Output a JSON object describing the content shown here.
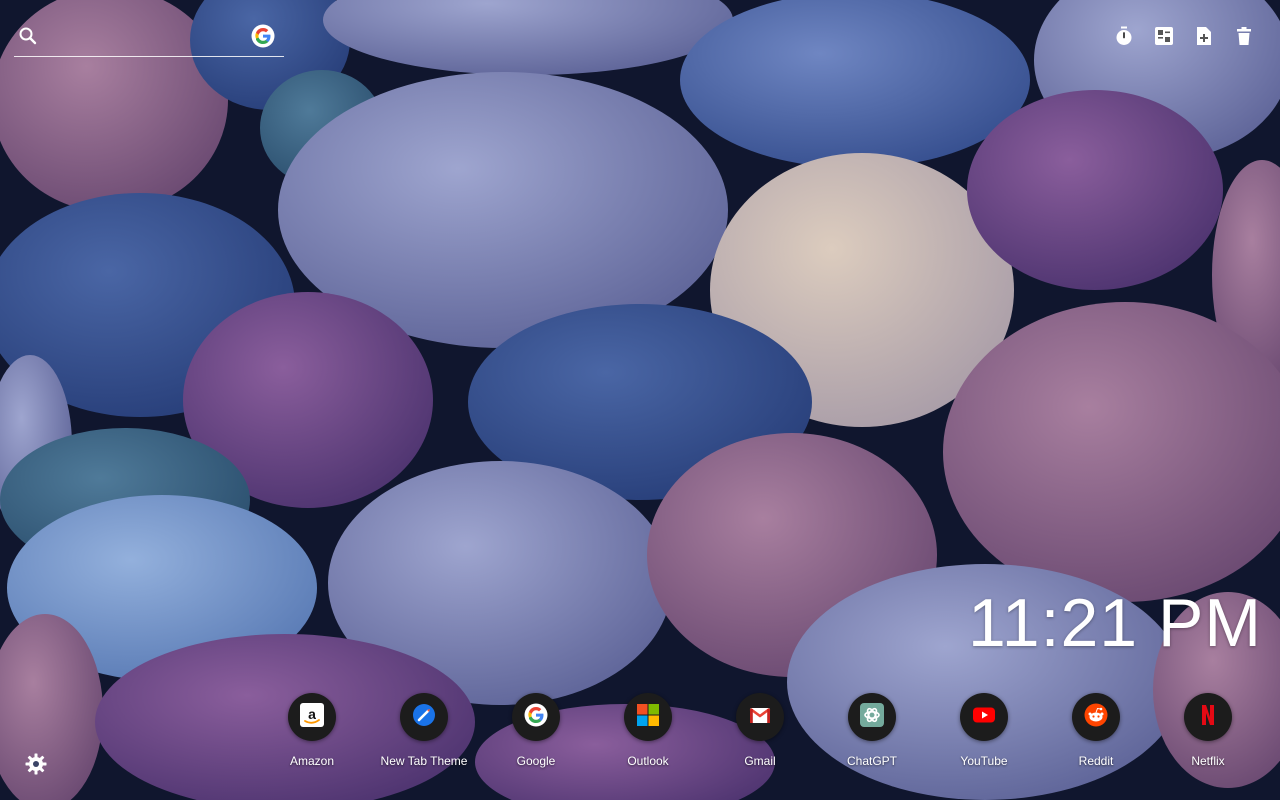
{
  "search": {
    "placeholder": "",
    "engine_icon": "google-g-icon"
  },
  "toolbar": {
    "icons": [
      "timer-icon",
      "widgets-icon",
      "add-file-icon",
      "trash-icon"
    ]
  },
  "clock": {
    "time": "11:21 PM"
  },
  "shortcuts": [
    {
      "label": "Amazon",
      "icon": "amazon-icon"
    },
    {
      "label": "New Tab Theme",
      "icon": "new-tab-theme-icon"
    },
    {
      "label": "Google",
      "icon": "google-icon"
    },
    {
      "label": "Outlook",
      "icon": "outlook-icon"
    },
    {
      "label": "Gmail",
      "icon": "gmail-icon"
    },
    {
      "label": "ChatGPT",
      "icon": "chatgpt-icon"
    },
    {
      "label": "YouTube",
      "icon": "youtube-icon"
    },
    {
      "label": "Reddit",
      "icon": "reddit-icon"
    },
    {
      "label": "Netflix",
      "icon": "netflix-icon"
    }
  ],
  "settings": {
    "icon": "gear-icon"
  },
  "colors": {
    "youtube": "#ff0000",
    "reddit": "#ff4500",
    "netflix": "#e50914",
    "chatgpt": "#74aa9c",
    "google_blue": "#4285f4",
    "google_red": "#ea4335",
    "google_yellow": "#fbbc05",
    "google_green": "#34a853"
  }
}
